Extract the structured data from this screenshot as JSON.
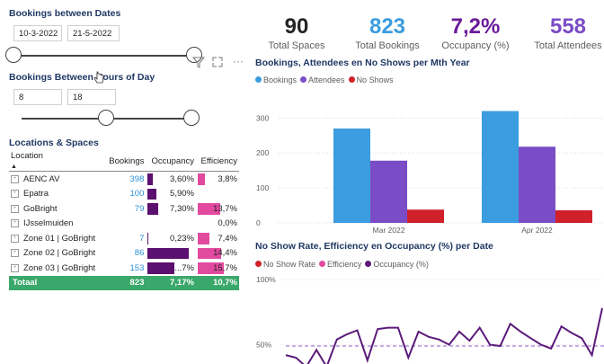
{
  "bookings_between_dates": {
    "title": "Bookings between Dates",
    "start": "10-3-2022",
    "end": "21-5-2022"
  },
  "bookings_between_hours": {
    "title": "Bookings Between Hours of Day",
    "start": "8",
    "end": "18"
  },
  "kpis": [
    {
      "value": "90",
      "label": "Total Spaces",
      "color": "#252423"
    },
    {
      "value": "823",
      "label": "Total Bookings",
      "color": "#3b9ddf"
    },
    {
      "value": "7,2%",
      "label": "Occupancy (%)",
      "color": "#6a1b9a"
    },
    {
      "value": "558",
      "label": "Total Attendees",
      "color": "#7a4cc6"
    }
  ],
  "locations": {
    "title": "Locations & Spaces",
    "headers": [
      "Location",
      "Bookings",
      "Occupancy",
      "Efficiency"
    ],
    "rows": [
      {
        "location": "AENC AV",
        "bookings": "398",
        "occupancy": "3,60%",
        "efficiency": "3,8%",
        "occ_level": 0.12,
        "eff_level": 0.18
      },
      {
        "location": "Epatra",
        "bookings": "100",
        "occupancy": "5,90%",
        "efficiency": "",
        "occ_level": 0.2,
        "eff_level": 0
      },
      {
        "location": "GoBright",
        "bookings": "79",
        "occupancy": "7,30%",
        "efficiency": "13,7%",
        "occ_level": 0.25,
        "eff_level": 0.6
      },
      {
        "location": "IJsselmuiden",
        "bookings": "",
        "occupancy": "",
        "efficiency": "0,0%",
        "occ_level": 0,
        "eff_level": 0
      },
      {
        "location": "Zone 01 | GoBright",
        "bookings": "7",
        "occupancy": "0,23%",
        "efficiency": "7,4%",
        "occ_level": 0.01,
        "eff_level": 0.32
      },
      {
        "location": "Zone 02 | GoBright",
        "bookings": "86",
        "occupancy": "",
        "efficiency": "14,4%",
        "occ_level": 1.0,
        "eff_level": 0.63
      },
      {
        "location": "Zone 03 | GoBright",
        "bookings": "153",
        "occupancy": "...7%",
        "efficiency": "15,7%",
        "occ_level": 0.65,
        "eff_level": 0.68
      }
    ],
    "total": {
      "label": "Totaal",
      "bookings": "823",
      "occupancy": "7,17%",
      "efficiency": "10,7%"
    }
  },
  "chart1_title": "Bookings, Attendees en No Shows per Mth Year",
  "chart2_title": "No Show Rate, Efficiency en Occupancy (%) per Date",
  "chart2_legend": [
    "No Show Rate",
    "Efficiency",
    "Occupancy (%)"
  ],
  "chart2_ticks": [
    "100%",
    "50%"
  ],
  "chart_data": [
    {
      "type": "bar",
      "title": "Bookings, Attendees en No Shows per Mth Year",
      "categories": [
        "Mar 2022",
        "Apr 2022"
      ],
      "series": [
        {
          "name": "Bookings",
          "values": [
            270,
            320
          ],
          "color": "#3b9ddf"
        },
        {
          "name": "Attendees",
          "values": [
            178,
            218
          ],
          "color": "#7a4cc6"
        },
        {
          "name": "No Shows",
          "values": [
            38,
            36
          ],
          "color": "#d0202a"
        }
      ],
      "yticks": [
        "300",
        "200",
        "100",
        "0"
      ],
      "ylim": [
        0,
        360
      ],
      "legend": "top-left"
    },
    {
      "type": "line",
      "title": "No Show Rate, Efficiency en Occupancy (%) per Date",
      "series": [
        {
          "name": "Occupancy (%)",
          "color": "#5b1a7a",
          "values": [
            42,
            40,
            33,
            46,
            33,
            54,
            58,
            61,
            38,
            62,
            63,
            63,
            40,
            60,
            56,
            54,
            50,
            60,
            53,
            63,
            50,
            49,
            66,
            60,
            55,
            50,
            47,
            64,
            59,
            55,
            42,
            78
          ]
        },
        {
          "name": "No Show Rate",
          "color": "#d0202a",
          "values": []
        },
        {
          "name": "Efficiency",
          "color": "#e24aa0",
          "values": []
        }
      ],
      "avg_line": 49,
      "yticks": [
        "100%",
        "50%"
      ],
      "ylim": [
        0,
        100
      ],
      "legend": "top-left"
    }
  ]
}
